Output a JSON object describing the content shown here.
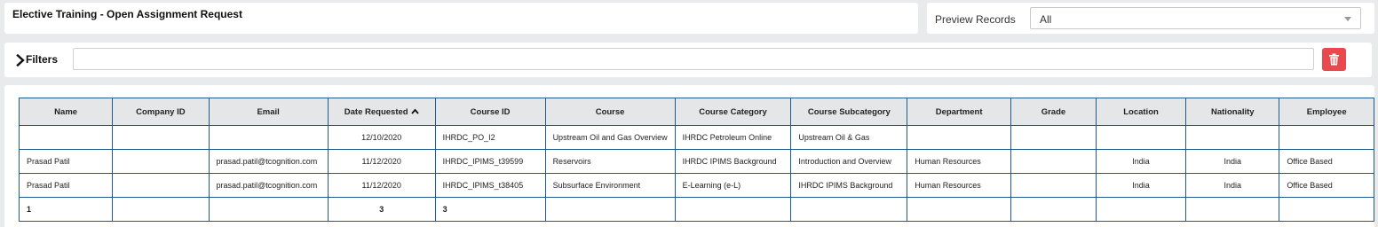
{
  "header": {
    "title": "Elective Training - Open Assignment Request",
    "preview_label": "Preview Records",
    "preview_value": "All"
  },
  "filters": {
    "label": "Filters",
    "value": ""
  },
  "icons": {
    "filters_toggle": "chevron-right-icon",
    "clear": "trash-icon",
    "sort": "sort-ascending-icon"
  },
  "colors": {
    "clear_button": "#e9494d",
    "grid_border": "#1f5a8c",
    "header_bg": "#e4e6e8"
  },
  "grid": {
    "columns": [
      "Name",
      "Company ID",
      "Email",
      "Date Requested",
      "Course ID",
      "Course",
      "Course Category",
      "Course Subcategory",
      "Department",
      "Grade",
      "Location",
      "Nationality",
      "Employee"
    ],
    "sorted_column": "Date Requested",
    "rows": [
      [
        "",
        "",
        "",
        "12/10/2020",
        "IHRDC_PO_I2",
        "Upstream Oil and Gas Overview",
        "IHRDC Petroleum Online",
        "Upstream Oil & Gas",
        "",
        "",
        "",
        "",
        ""
      ],
      [
        "Prasad Patil",
        "",
        "prasad.patil@tcognition.com",
        "11/12/2020",
        "IHRDC_IPIMS_t39599",
        "Reservoirs",
        "IHRDC IPIMS Background",
        "Introduction and Overview",
        "Human Resources",
        "",
        "India",
        "India",
        "Office Based"
      ],
      [
        "Prasad Patil",
        "",
        "prasad.patil@tcognition.com",
        "11/12/2020",
        "IHRDC_IPIMS_t38405",
        "Subsurface Environment",
        "E-Learning (e-L)",
        "IHRDC IPIMS Background",
        "Human Resources",
        "",
        "India",
        "India",
        "Office Based"
      ]
    ],
    "totals": [
      "1",
      "",
      "",
      "3",
      "3",
      "",
      "",
      "",
      "",
      "",
      "",
      "",
      ""
    ]
  }
}
